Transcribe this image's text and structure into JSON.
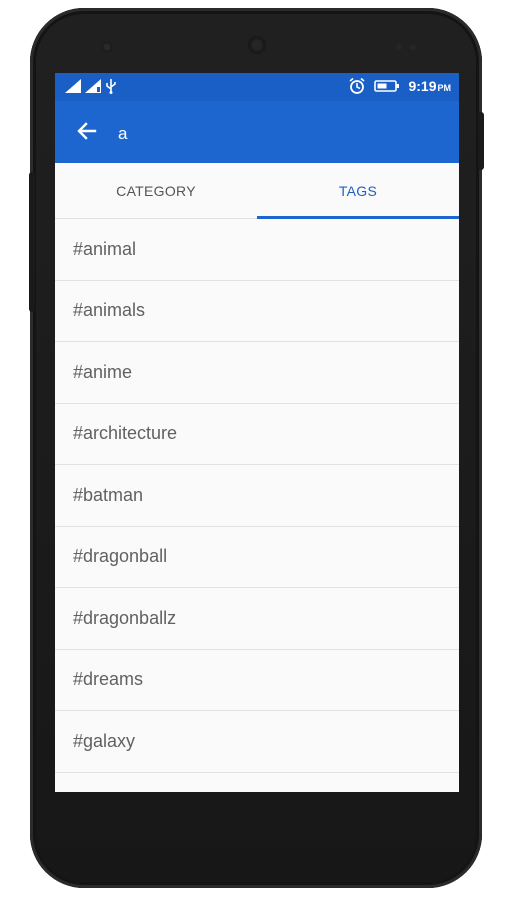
{
  "status_bar": {
    "time": "9:19",
    "ampm": "PM",
    "icons": [
      "signal-icon",
      "signal-icon",
      "usb-icon",
      "alarm-icon",
      "battery-icon"
    ]
  },
  "app_bar": {
    "back_icon": "arrow-back-icon",
    "search_query": "a",
    "background": "#1e66cf"
  },
  "tabs": [
    {
      "label": "CATEGORY",
      "selected": false
    },
    {
      "label": "TAGS",
      "selected": true
    }
  ],
  "tags": [
    "#animal",
    "#animals",
    "#anime",
    "#architecture",
    "#batman",
    "#dragonball",
    "#dragonballz",
    "#dreams",
    "#galaxy"
  ],
  "colors": {
    "accent": "#1e66cf",
    "status_bar": "#1a5fc5",
    "tab_active": "#1e5fc4",
    "text": "#616161"
  }
}
